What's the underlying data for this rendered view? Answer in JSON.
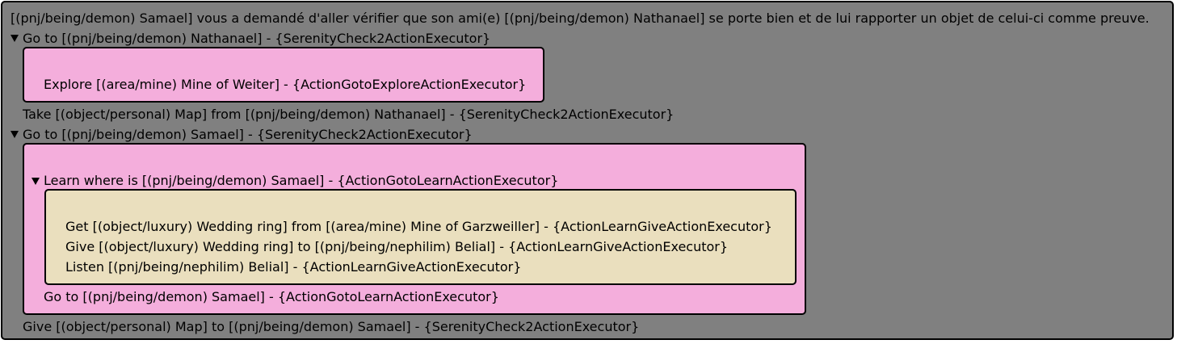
{
  "quest": {
    "description": "[(pnj/being/demon) Samael] vous a demandé d'aller vérifier que son ami(e) [(pnj/being/demon) Nathanael] se porte bien et de lui rapporter un objet de celui-ci comme preuve.",
    "steps": {
      "goto_nathanael": "Go to [(pnj/being/demon) Nathanael] - {SerenityCheck2ActionExecutor}",
      "explore_mine_weiter": "Explore [(area/mine) Mine of Weiter] - {ActionGotoExploreActionExecutor}",
      "take_map": "Take [(object/personal) Map] from [(pnj/being/demon) Nathanael] - {SerenityCheck2ActionExecutor}",
      "goto_samael": "Go to [(pnj/being/demon) Samael] - {SerenityCheck2ActionExecutor}",
      "learn_where_samael": "Learn where is [(pnj/being/demon) Samael] - {ActionGotoLearnActionExecutor}",
      "get_wedding_ring": "Get [(object/luxury) Wedding ring] from [(area/mine) Mine of Garzweiller] - {ActionLearnGiveActionExecutor}",
      "give_wedding_ring": "Give [(object/luxury) Wedding ring] to [(pnj/being/nephilim) Belial] - {ActionLearnGiveActionExecutor}",
      "listen_belial": "Listen [(pnj/being/nephilim) Belial] - {ActionLearnGiveActionExecutor}",
      "goto_samael_learn": "Go to [(pnj/being/demon) Samael] - {ActionGotoLearnActionExecutor}",
      "give_map": "Give [(object/personal) Map] to [(pnj/being/demon) Samael] - {SerenityCheck2ActionExecutor}"
    }
  },
  "colors": {
    "panel": "#808080",
    "subtask_box": "#f4aedc",
    "learn_box": "#eadfbe"
  }
}
